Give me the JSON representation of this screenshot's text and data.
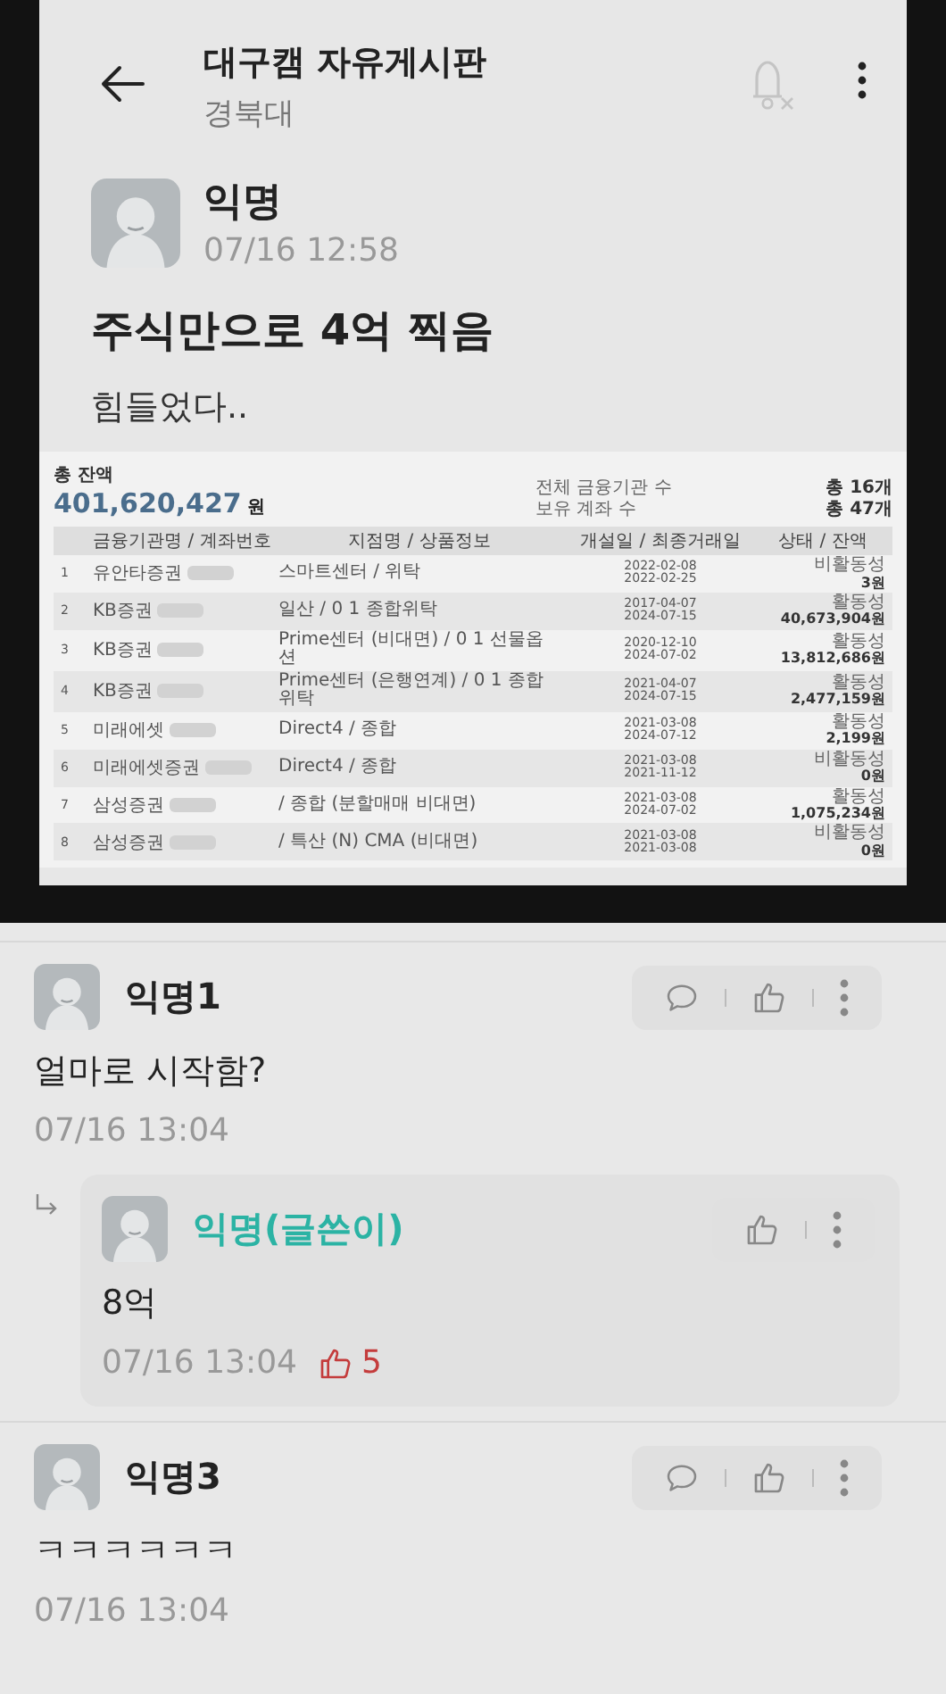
{
  "header": {
    "title": "대구캠 자유게시판",
    "subtitle": "경북대"
  },
  "post": {
    "author": "익명",
    "time": "07/16 12:58",
    "title": "주식만으로 4억 찍음",
    "body": "힘들었다..",
    "attachment": {
      "kind": "document",
      "total_label": "총 잔액",
      "total_amount": "401,620,427",
      "total_unit": "원",
      "stats": [
        {
          "label": "전체 금융기관 수",
          "value": "총 16개"
        },
        {
          "label": "보유 계좌 수",
          "value": "총 47개"
        }
      ],
      "columns": [
        "금융기관명 / 계좌번호",
        "지점명 / 상품정보",
        "개설일 / 최종거래일",
        "상태 / 잔액"
      ],
      "rows": [
        {
          "no": "1",
          "institution": "유안타증권",
          "product": "스마트센터 / 위탁",
          "opened": "2022-02-08",
          "last_traded": "2022-02-25",
          "status": "비활동성",
          "balance": "3원"
        },
        {
          "no": "2",
          "institution": "KB증권",
          "product": "일산 / 0 1 종합위탁",
          "opened": "2017-04-07",
          "last_traded": "2024-07-15",
          "status": "활동성",
          "balance": "40,673,904원"
        },
        {
          "no": "3",
          "institution": "KB증권",
          "product": "Prime센터 (비대면) / 0 1 선물옵션",
          "opened": "2020-12-10",
          "last_traded": "2024-07-02",
          "status": "활동성",
          "balance": "13,812,686원"
        },
        {
          "no": "4",
          "institution": "KB증권",
          "product": "Prime센터 (은행연계) / 0 1 종합위탁",
          "opened": "2021-04-07",
          "last_traded": "2024-07-15",
          "status": "활동성",
          "balance": "2,477,159원"
        },
        {
          "no": "5",
          "institution": "미래에셋",
          "product": "Direct4 / 종합",
          "opened": "2021-03-08",
          "last_traded": "2024-07-12",
          "status": "활동성",
          "balance": "2,199원"
        },
        {
          "no": "6",
          "institution": "미래에셋증권",
          "product": "Direct4 / 종합",
          "opened": "2021-03-08",
          "last_traded": "2021-11-12",
          "status": "비활동성",
          "balance": "0원"
        },
        {
          "no": "7",
          "institution": "삼성증권",
          "product": "/ 종합 (분할매매 비대면)",
          "opened": "2021-03-08",
          "last_traded": "2024-07-02",
          "status": "활동성",
          "balance": "1,075,234원"
        },
        {
          "no": "8",
          "institution": "삼성증권",
          "product": "/ 특산 (N) CMA (비대면)",
          "opened": "2021-03-08",
          "last_traded": "2021-03-08",
          "status": "비활동성",
          "balance": "0원"
        }
      ]
    }
  },
  "comments": [
    {
      "kind": "comment",
      "author": "익명1",
      "writer": false,
      "text": "얼마로 시작함?",
      "time": "07/16 13:04",
      "replies": [
        {
          "kind": "reply",
          "author": "익명(글쓴이)",
          "writer": true,
          "text": "8억",
          "time": "07/16 13:04",
          "likes": "5"
        }
      ]
    },
    {
      "kind": "comment",
      "author": "익명3",
      "writer": false,
      "text": "ㅋㅋㅋㅋㅋㅋ",
      "time": "07/16 13:04"
    }
  ]
}
